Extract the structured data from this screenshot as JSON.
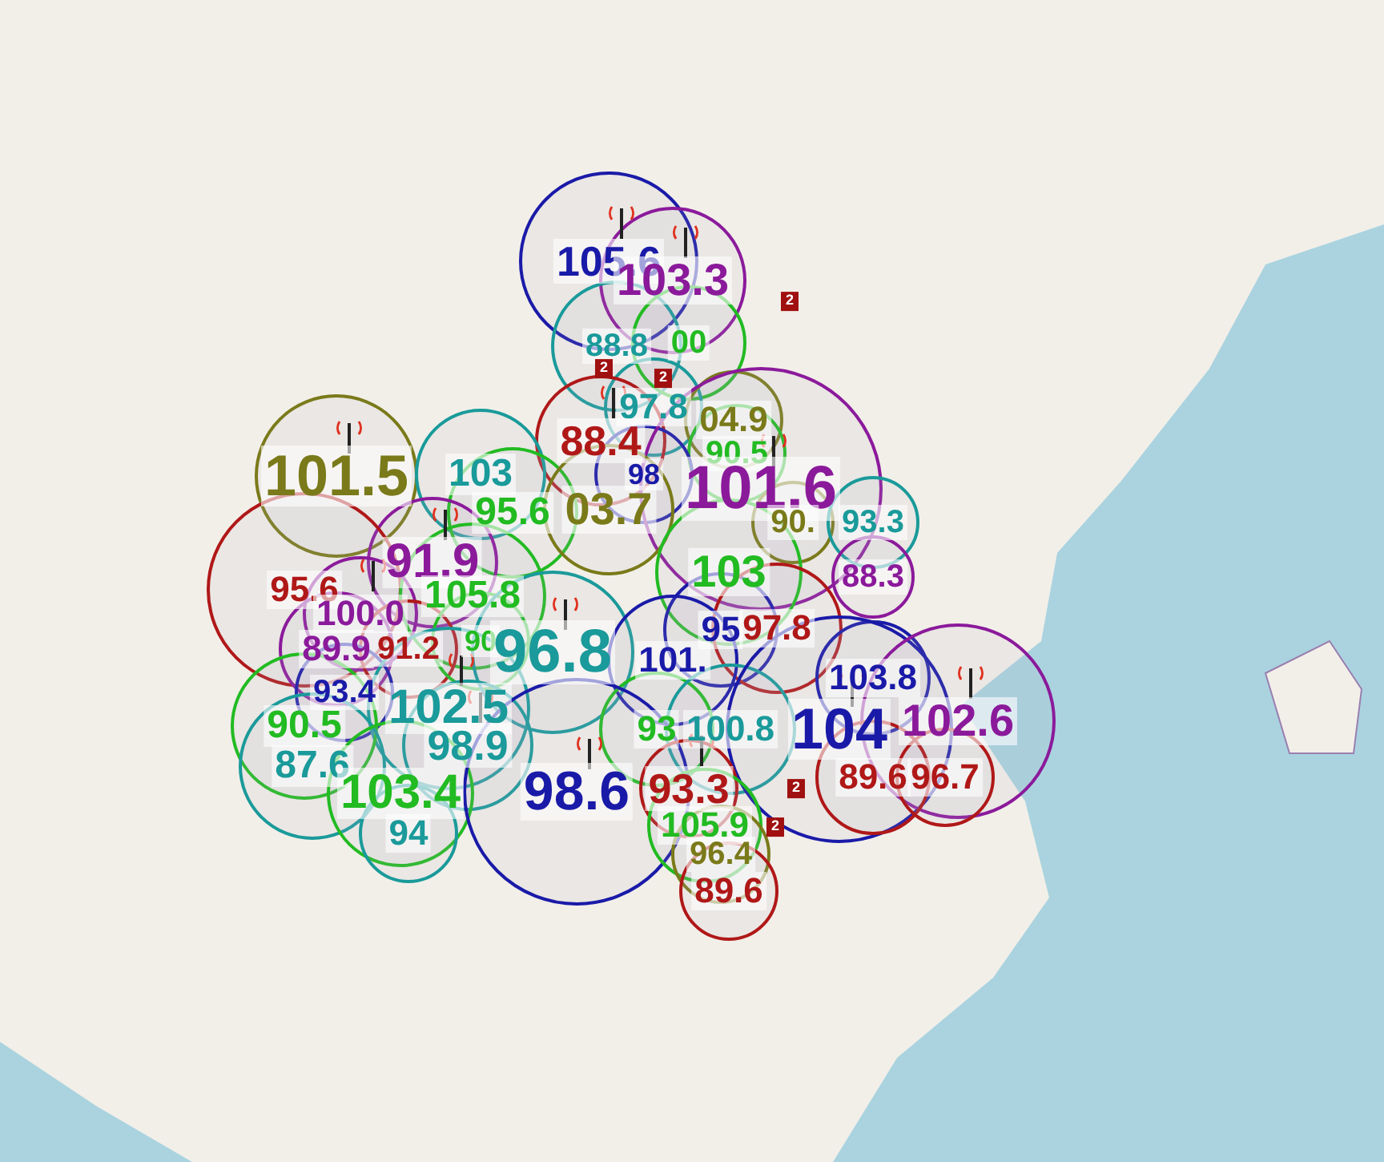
{
  "stations": [
    {
      "label": "105.6",
      "color": "#1a1aa8"
    },
    {
      "label": "103.3",
      "color": "#8b1a9b"
    },
    {
      "label": "88.8",
      "color": "#1a9a9a"
    },
    {
      "label": "00",
      "color": "#22bb22"
    },
    {
      "label": "97.8",
      "color": "#1a9a9a"
    },
    {
      "label": "04.9",
      "color": "#7a7a1a"
    },
    {
      "label": "88.4",
      "color": "#b01818"
    },
    {
      "label": "90.5",
      "color": "#22bb22"
    },
    {
      "label": "101.5",
      "color": "#7a7a1a"
    },
    {
      "label": "103",
      "color": "#1a9a9a"
    },
    {
      "label": "98",
      "color": "#1a1aa8"
    },
    {
      "label": "101.6",
      "color": "#8b1a9b"
    },
    {
      "label": "95.6",
      "color": "#22bb22"
    },
    {
      "label": "03.7",
      "color": "#7a7a1a"
    },
    {
      "label": "90.",
      "color": "#7a7a1a"
    },
    {
      "label": "93.3",
      "color": "#1a9a9a"
    },
    {
      "label": "91.9",
      "color": "#8b1a9b"
    },
    {
      "label": "103",
      "color": "#22bb22"
    },
    {
      "label": "88.3",
      "color": "#8b1a9b"
    },
    {
      "label": "95.6",
      "color": "#b01818"
    },
    {
      "label": "105.8",
      "color": "#22bb22"
    },
    {
      "label": "100.0",
      "color": "#8b1a9b"
    },
    {
      "label": "95",
      "color": "#1a1aa8"
    },
    {
      "label": "97.8",
      "color": "#b01818"
    },
    {
      "label": "89.9",
      "color": "#8b1a9b"
    },
    {
      "label": "91.2",
      "color": "#b01818"
    },
    {
      "label": "90",
      "color": "#22bb22"
    },
    {
      "label": "96.8",
      "color": "#1a9a9a"
    },
    {
      "label": "101.",
      "color": "#1a1aa8"
    },
    {
      "label": "103.8",
      "color": "#1a1aa8"
    },
    {
      "label": "93.4",
      "color": "#1a1aa8"
    },
    {
      "label": "102.5",
      "color": "#1a9a9a"
    },
    {
      "label": "90.5",
      "color": "#22bb22"
    },
    {
      "label": "93",
      "color": "#22bb22"
    },
    {
      "label": "100.8",
      "color": "#1a9a9a"
    },
    {
      "label": "104",
      "color": "#1a1aa8"
    },
    {
      "label": "102.6",
      "color": "#8b1a9b"
    },
    {
      "label": "98.9",
      "color": "#1a9a9a"
    },
    {
      "label": "87.6",
      "color": "#1a9a9a"
    },
    {
      "label": "89.6",
      "color": "#b01818"
    },
    {
      "label": "96.7",
      "color": "#b01818"
    },
    {
      "label": "103.4",
      "color": "#22bb22"
    },
    {
      "label": "98.6",
      "color": "#1a1aa8"
    },
    {
      "label": "93.3",
      "color": "#b01818"
    },
    {
      "label": "105.9",
      "color": "#22bb22"
    },
    {
      "label": "94",
      "color": "#1a9a9a"
    },
    {
      "label": "96.4",
      "color": "#7a7a1a"
    },
    {
      "label": "89.6",
      "color": "#b01818"
    }
  ],
  "clusters": [
    {
      "count": "2"
    },
    {
      "count": "2"
    },
    {
      "count": "2"
    },
    {
      "count": "2"
    },
    {
      "count": "2"
    }
  ]
}
